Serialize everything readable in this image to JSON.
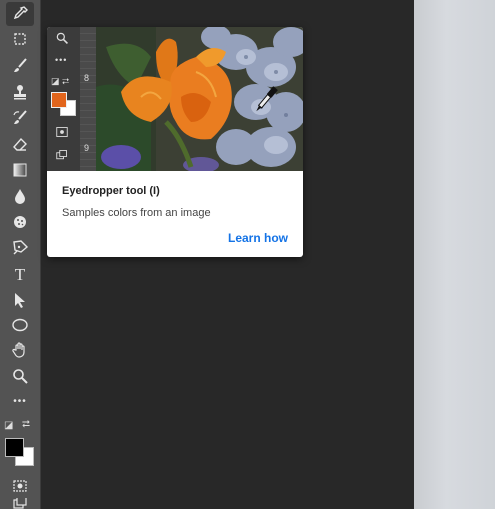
{
  "toolbar": {
    "tools": [
      {
        "name": "eyedropper-tool",
        "icon": "eyedropper-icon",
        "selected": true
      },
      {
        "name": "artboard-tool",
        "icon": "artboard-icon"
      },
      {
        "name": "brush-tool",
        "icon": "brush-icon"
      },
      {
        "name": "clone-stamp-tool",
        "icon": "stamp-icon"
      },
      {
        "name": "history-brush-tool",
        "icon": "history-brush-icon"
      },
      {
        "name": "eraser-tool",
        "icon": "eraser-icon"
      },
      {
        "name": "gradient-tool",
        "icon": "gradient-icon"
      },
      {
        "name": "blur-tool",
        "icon": "drop-icon"
      },
      {
        "name": "sponge-tool",
        "icon": "sponge-icon"
      },
      {
        "name": "pen-tool",
        "icon": "pen-icon"
      },
      {
        "name": "type-tool",
        "icon": "type-icon",
        "glyph": "T"
      },
      {
        "name": "path-selection-tool",
        "icon": "arrow-icon"
      },
      {
        "name": "ellipse-tool",
        "icon": "ellipse-icon"
      },
      {
        "name": "hand-tool",
        "icon": "hand-icon"
      },
      {
        "name": "zoom-tool",
        "icon": "zoom-icon"
      },
      {
        "name": "more-tools",
        "icon": "more-icon",
        "glyph": "•••"
      }
    ],
    "foreground_color": "#000000",
    "background_color": "#ffffff"
  },
  "tooltip": {
    "title": "Eyedropper tool (I)",
    "description": "Samples colors from an image",
    "link": "Learn how",
    "preview": {
      "ruler_marks": [
        "8",
        "9"
      ],
      "foreground_color": "#e2651c",
      "background_color": "#ffffff"
    }
  },
  "colors": {
    "accent": "#1473e6",
    "toolbar_bg": "#535353",
    "workspace_bg": "#282828"
  }
}
